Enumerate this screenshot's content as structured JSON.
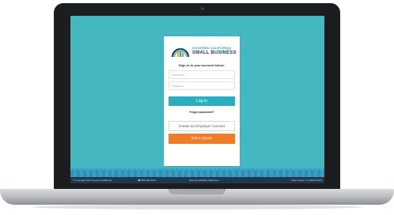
{
  "login_card": {
    "brand_line1": "COVERED CALIFORNIA",
    "brand_line2": "SMALL BUSINESS",
    "heading": "Sign in to your account below:",
    "username_placeholder": "Username",
    "password_placeholder": "Password",
    "login_label": "Log In",
    "forgot_label": "Forgot password?",
    "create_account_label": "Create an Employer Account",
    "quote_label": "Get a Quote"
  },
  "footer": {
    "copyright": "© Copyright 2014 Covered California",
    "phone": "☎ 855-650-6070",
    "accessibility": "Web Accessibility Statement",
    "version": "Web Version: 1.0.0001 01/13"
  },
  "colors": {
    "screen_bg": "#45b7c1",
    "primary_button": "#2aaec0",
    "quote_button": "#f07c2a",
    "footer_bg": "#22374f"
  }
}
